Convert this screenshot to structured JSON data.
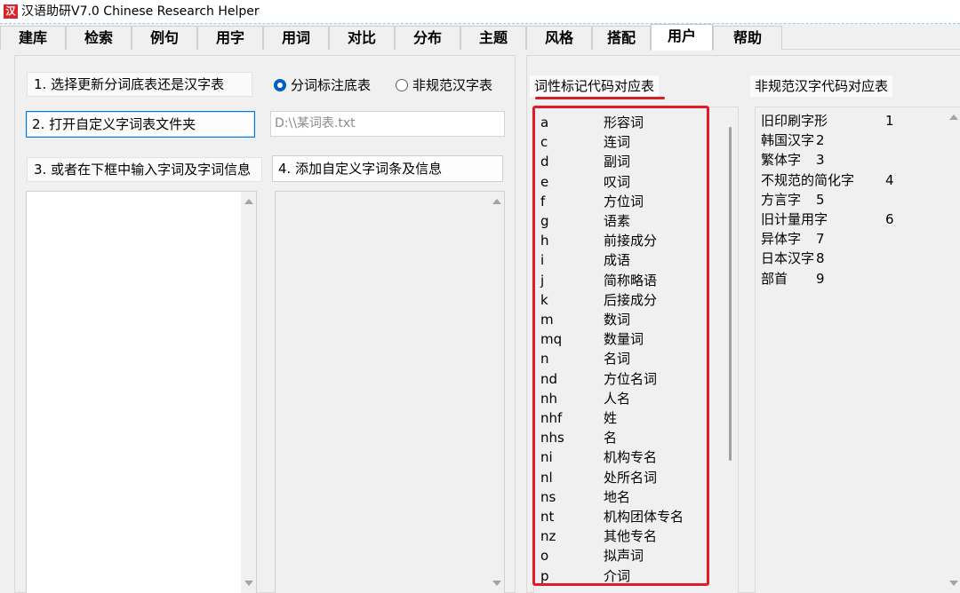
{
  "window": {
    "title": "汉语助研V7.0  Chinese Research Helper",
    "icon_text": "汉",
    "icon_color": "#d8262d"
  },
  "tabs": [
    {
      "label": "建库",
      "active": false
    },
    {
      "label": "检索",
      "active": false
    },
    {
      "label": "例句",
      "active": false
    },
    {
      "label": "用字",
      "active": false
    },
    {
      "label": "用词",
      "active": false
    },
    {
      "label": "对比",
      "active": false
    },
    {
      "label": "分布",
      "active": false
    },
    {
      "label": "主题",
      "active": false
    },
    {
      "label": "风格",
      "active": false
    },
    {
      "label": "搭配",
      "active": false
    },
    {
      "label": "用户",
      "active": true
    },
    {
      "label": "帮助",
      "active": false
    }
  ],
  "left_panel": {
    "step1_label": "1. 选择更新分词底表还是汉字表",
    "radio_options": [
      {
        "label": "分词标注底表",
        "checked": true
      },
      {
        "label": "非规范汉字表",
        "checked": false
      }
    ],
    "step2_button": "2. 打开自定义字词表文件夹",
    "file_path_placeholder": "D:\\\\某词表.txt",
    "step3_label": "3. 或者在下框中输入字词及字词信息",
    "step4_button": "4. 添加自定义字词条及信息"
  },
  "pos_table": {
    "title": "词性标记代码对应表",
    "highlight_color": "#e01c2a",
    "rows": [
      {
        "code": "a",
        "name": "形容词"
      },
      {
        "code": "c",
        "name": "连词"
      },
      {
        "code": "d",
        "name": "副词"
      },
      {
        "code": "e",
        "name": "叹词"
      },
      {
        "code": "f",
        "name": "方位词"
      },
      {
        "code": "g",
        "name": "语素"
      },
      {
        "code": "h",
        "name": "前接成分"
      },
      {
        "code": "i",
        "name": "成语"
      },
      {
        "code": "j",
        "name": "简称略语"
      },
      {
        "code": "k",
        "name": "后接成分"
      },
      {
        "code": "m",
        "name": "数词"
      },
      {
        "code": "mq",
        "name": "数量词"
      },
      {
        "code": "n",
        "name": "名词"
      },
      {
        "code": "nd",
        "name": "方位名词"
      },
      {
        "code": "nh",
        "name": "人名"
      },
      {
        "code": "nhf",
        "name": "姓"
      },
      {
        "code": "nhs",
        "name": "名"
      },
      {
        "code": "ni",
        "name": "机构专名"
      },
      {
        "code": "nl",
        "name": "处所名词"
      },
      {
        "code": "ns",
        "name": "地名"
      },
      {
        "code": "nt",
        "name": "机构团体专名"
      },
      {
        "code": "nz",
        "name": "其他专名"
      },
      {
        "code": "o",
        "name": "拟声词"
      },
      {
        "code": "p",
        "name": "介词"
      }
    ]
  },
  "nonstandard_table": {
    "title": "非规范汉字代码对应表",
    "rows": [
      {
        "name": "旧印刷字形",
        "code": "1"
      },
      {
        "name": "韩国汉字",
        "code": "2"
      },
      {
        "name": "繁体字",
        "code": "3"
      },
      {
        "name": "不规范的简化字",
        "code": "4"
      },
      {
        "name": "方言字",
        "code": "5"
      },
      {
        "name": "旧计量用字",
        "code": "6"
      },
      {
        "name": "异体字",
        "code": "7"
      },
      {
        "name": "日本汉字",
        "code": "8"
      },
      {
        "name": "部首",
        "code": "9"
      }
    ]
  }
}
